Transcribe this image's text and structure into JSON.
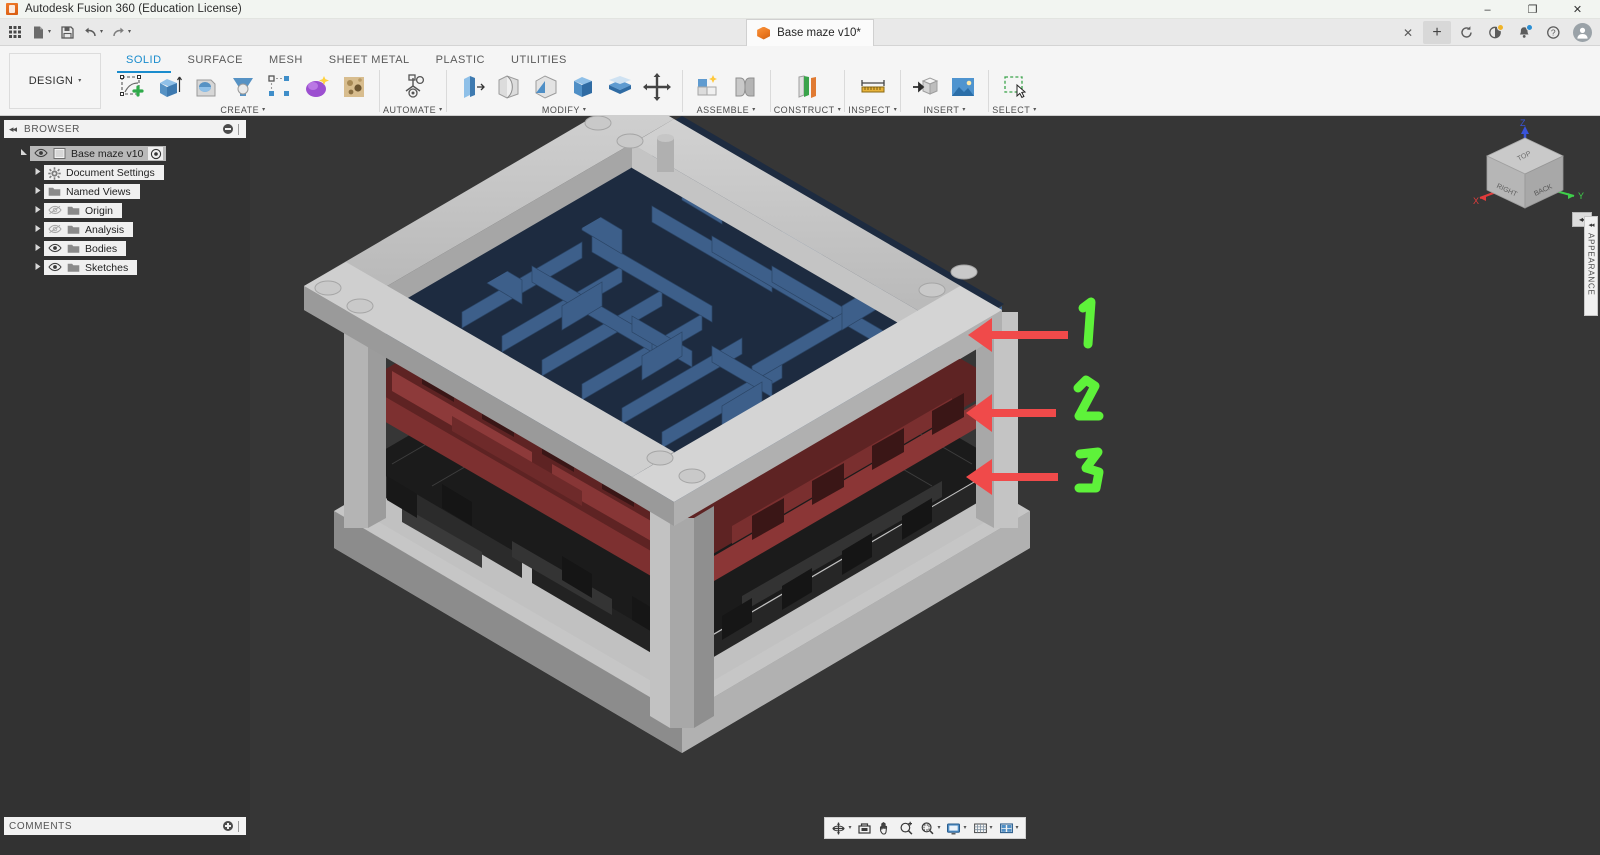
{
  "window": {
    "title": "Autodesk Fusion 360 (Education License)",
    "app_icon": "fusion-logo-icon",
    "minimize": "–",
    "maximize": "❐",
    "close": "✕"
  },
  "quick_access": {
    "items": [
      {
        "name": "app-grid-button",
        "icon": "grid-apps-icon"
      },
      {
        "name": "file-menu-button",
        "icon": "file-icon",
        "has_caret": true
      },
      {
        "name": "save-button",
        "icon": "save-disk-icon"
      },
      {
        "name": "undo-button",
        "icon": "undo-arrow-icon",
        "has_caret": true
      },
      {
        "name": "redo-button",
        "icon": "redo-arrow-icon",
        "has_caret": true
      }
    ],
    "document_tab": {
      "label": "Base maze v10*",
      "icon": "document-cube-icon",
      "close": "✕"
    },
    "new_tab": "+",
    "right_icons": [
      {
        "name": "refresh-sync-icon",
        "glyph": "⟳",
        "badge": false
      },
      {
        "name": "job-status-icon",
        "glyph": "◔",
        "badge": true,
        "badge_color": "gold"
      },
      {
        "name": "notifications-bell-icon",
        "glyph": "⚑",
        "badge": true,
        "badge_color": "blue"
      },
      {
        "name": "help-icon",
        "glyph": "?",
        "badge": false
      }
    ],
    "avatar_initial": "●"
  },
  "ribbon": {
    "workspace_selector": {
      "label": "DESIGN",
      "caret": "▾"
    },
    "tabs": [
      {
        "label": "SOLID",
        "active": true
      },
      {
        "label": "SURFACE",
        "active": false
      },
      {
        "label": "MESH",
        "active": false
      },
      {
        "label": "SHEET METAL",
        "active": false
      },
      {
        "label": "PLASTIC",
        "active": false
      },
      {
        "label": "UTILITIES",
        "active": false
      }
    ],
    "panels": [
      {
        "title": "CREATE",
        "caret": "▾",
        "tools": [
          {
            "name": "create-sketch-tool",
            "icon": "sketch-plus-icon"
          },
          {
            "name": "extrude-tool",
            "icon": "extrude-icon"
          },
          {
            "name": "revolve-tool",
            "icon": "revolve-icon"
          },
          {
            "name": "sweep-tool",
            "icon": "sweep-icon"
          },
          {
            "name": "pattern-tool",
            "icon": "rectangular-pattern-icon"
          },
          {
            "name": "create-form-tool",
            "icon": "form-sculpt-icon"
          },
          {
            "name": "create-mesh-tool",
            "icon": "mesh-texture-icon"
          }
        ]
      },
      {
        "title": "AUTOMATE",
        "caret": "▾",
        "tools": [
          {
            "name": "automate-tool",
            "icon": "automate-node-icon"
          }
        ]
      },
      {
        "title": "MODIFY",
        "caret": "▾",
        "tools": [
          {
            "name": "press-pull-tool",
            "icon": "press-pull-icon"
          },
          {
            "name": "fillet-tool",
            "icon": "fillet-icon"
          },
          {
            "name": "chamfer-tool",
            "icon": "chamfer-icon"
          },
          {
            "name": "shell-tool",
            "icon": "shell-icon"
          },
          {
            "name": "offset-face-tool",
            "icon": "offset-face-icon"
          },
          {
            "name": "move-copy-tool",
            "icon": "move-arrows-icon"
          }
        ]
      },
      {
        "title": "ASSEMBLE",
        "caret": "▾",
        "tools": [
          {
            "name": "new-component-tool",
            "icon": "new-component-icon"
          },
          {
            "name": "joint-tool",
            "icon": "joint-icon"
          }
        ]
      },
      {
        "title": "CONSTRUCT",
        "caret": "▾",
        "tools": [
          {
            "name": "construct-plane-tool",
            "icon": "offset-plane-icon"
          }
        ]
      },
      {
        "title": "INSPECT",
        "caret": "▾",
        "tools": [
          {
            "name": "measure-tool",
            "icon": "measure-ruler-icon"
          }
        ]
      },
      {
        "title": "INSERT",
        "caret": "▾",
        "tools": [
          {
            "name": "insert-derive-tool",
            "icon": "insert-derive-icon"
          },
          {
            "name": "insert-canvas-tool",
            "icon": "insert-image-icon"
          }
        ]
      },
      {
        "title": "SELECT",
        "caret": "▾",
        "tools": [
          {
            "name": "select-tool",
            "icon": "selection-cursor-icon"
          }
        ]
      }
    ]
  },
  "browser": {
    "header": {
      "title": "BROWSER",
      "collapse_icon": "◂◂",
      "minimize_icon": "minus-circle-icon"
    },
    "tree": [
      {
        "label": "Base maze v10",
        "indent": 0,
        "twisty": "expanded",
        "eye": "visible",
        "icon": "document-icon",
        "root": true,
        "target_icon": "target-circle-icon"
      },
      {
        "label": "Document Settings",
        "indent": 1,
        "twisty": "collapsed",
        "eye": "none",
        "icon": "gear-icon"
      },
      {
        "label": "Named Views",
        "indent": 1,
        "twisty": "collapsed",
        "eye": "none",
        "icon": "folder-icon"
      },
      {
        "label": "Origin",
        "indent": 1,
        "twisty": "collapsed",
        "eye": "hidden",
        "icon": "folder-icon"
      },
      {
        "label": "Analysis",
        "indent": 1,
        "twisty": "collapsed",
        "eye": "hidden",
        "icon": "folder-icon"
      },
      {
        "label": "Bodies",
        "indent": 1,
        "twisty": "collapsed",
        "eye": "visible",
        "icon": "folder-icon"
      },
      {
        "label": "Sketches",
        "indent": 1,
        "twisty": "collapsed",
        "eye": "visible",
        "icon": "folder-icon"
      }
    ]
  },
  "viewport": {
    "background_color": "#363636",
    "model": {
      "name": "Base maze v10 - three-layer stacked maze assembly",
      "frame_color": "#b4b4b4",
      "layers": [
        {
          "number": "1",
          "name": "top-maze-layer",
          "color": "#3d5f8a"
        },
        {
          "number": "2",
          "name": "middle-maze-layer",
          "color": "#7a3030"
        },
        {
          "number": "3",
          "name": "bottom-maze-layer",
          "color": "#1d1d1d"
        }
      ]
    },
    "annotations": {
      "arrow_color": "#f04a4a",
      "label_color": "#5ef23a",
      "markers": [
        {
          "label": "1",
          "target": "top-maze-layer"
        },
        {
          "label": "2",
          "target": "middle-maze-layer"
        },
        {
          "label": "3",
          "target": "bottom-maze-layer"
        }
      ]
    },
    "viewcube": {
      "faces": {
        "top": "TOP",
        "left": "RIGHT",
        "right": "BACK"
      },
      "axes": [
        {
          "label": "X",
          "color": "#e23b3b"
        },
        {
          "label": "Y",
          "color": "#3ecf4a"
        },
        {
          "label": "Z",
          "color": "#3a54d8"
        }
      ],
      "collapse_icon": "◂◂"
    },
    "appearance_panel": {
      "label": "APPEARANCE",
      "arrow": "◂◂"
    }
  },
  "navbar": {
    "items": [
      {
        "name": "orbit-tool",
        "icon": "orbit-icon",
        "caret": "▾"
      },
      {
        "name": "look-at-tool",
        "icon": "look-at-icon",
        "caret": ""
      },
      {
        "name": "pan-tool",
        "icon": "pan-hand-icon",
        "caret": ""
      },
      {
        "name": "zoom-tool",
        "icon": "zoom-plus-icon",
        "caret": ""
      },
      {
        "name": "zoom-window-tool",
        "icon": "zoom-window-icon",
        "caret": "▾"
      },
      {
        "name": "display-settings",
        "icon": "display-monitor-icon",
        "caret": "▾"
      },
      {
        "name": "grid-snaps",
        "icon": "grid-icon",
        "caret": "▾"
      },
      {
        "name": "viewports",
        "icon": "viewports-icon",
        "caret": "▾"
      }
    ]
  },
  "comments": {
    "title": "COMMENTS",
    "add_icon": "plus-circle-icon"
  }
}
